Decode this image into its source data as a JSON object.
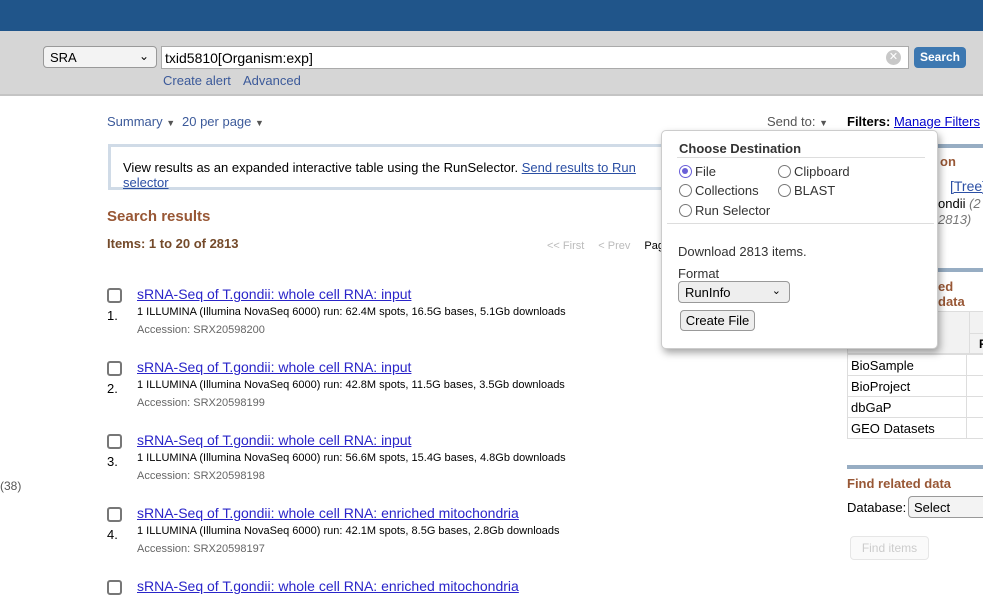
{
  "search": {
    "database": "SRA",
    "term": "txid5810[Organism:exp]",
    "search_label": "Search",
    "create_alert": "Create alert",
    "advanced": "Advanced"
  },
  "toolbar": {
    "summary": "Summary",
    "per_page": "20 per page",
    "send_to": "Send to:",
    "filters_label": "Filters:",
    "manage_filters": "Manage Filters"
  },
  "run_selector": {
    "text": "View results as an expanded interactive table using the RunSelector.",
    "link": "Send results to Run selector"
  },
  "results": {
    "title": "Search results",
    "items": "Items: 1 to 20 of 2813",
    "pager": {
      "first": "<< First",
      "prev": "< Prev",
      "page": "Page"
    },
    "list": [
      {
        "num": "1.",
        "title": "sRNA-Seq of T.gondii: whole cell RNA: input",
        "desc": "1 ILLUMINA (Illumina NovaSeq 6000) run: 62.4M spots, 16.5G bases, 5.1Gb downloads",
        "accession": "Accession: SRX20598200"
      },
      {
        "num": "2.",
        "title": "sRNA-Seq of T.gondii: whole cell RNA: input",
        "desc": "1 ILLUMINA (Illumina NovaSeq 6000) run: 42.8M spots, 11.5G bases, 3.5Gb downloads",
        "accession": "Accession: SRX20598199"
      },
      {
        "num": "3.",
        "title": "sRNA-Seq of T.gondii: whole cell RNA: input",
        "desc": "1 ILLUMINA (Illumina NovaSeq 6000) run: 56.6M spots, 15.4G bases, 4.8Gb downloads",
        "accession": "Accession: SRX20598198"
      },
      {
        "num": "4.",
        "title": "sRNA-Seq of T.gondii: whole cell RNA: enriched mitochondria",
        "desc": "1 ILLUMINA (Illumina NovaSeq 6000) run: 42.1M spots, 8.5G bases, 2.8Gb downloads",
        "accession": "Accession: SRX20598197"
      },
      {
        "num": "",
        "title": "sRNA-Seq of T.gondii: whole cell RNA: enriched mitochondria",
        "desc": "",
        "accession": ""
      }
    ]
  },
  "left_count": "(38)",
  "right": {
    "heading1_fragment": "on",
    "tree": "[Tree]",
    "organism_fragment": "ondii",
    "count_fragment1": "(2",
    "count_fragment2": "2813)",
    "heading2_fragment": "ed data",
    "table_header_fragment": "R",
    "related": [
      "BioSample",
      "BioProject",
      "dbGaP",
      "GEO Datasets"
    ],
    "find_heading": "Find related data",
    "database_label": "Database:",
    "database_value": "Select",
    "find_items": "Find items"
  },
  "popup": {
    "title": "Choose Destination",
    "options": [
      {
        "label": "File",
        "selected": true
      },
      {
        "label": "Clipboard",
        "selected": false
      },
      {
        "label": "Collections",
        "selected": false
      },
      {
        "label": "BLAST",
        "selected": false
      },
      {
        "label": "Run Selector",
        "selected": false
      }
    ],
    "download_text": "Download 2813 items.",
    "format_label": "Format",
    "format_value": "RunInfo",
    "create_file": "Create File"
  },
  "colors": {
    "header": "#20558a",
    "search_button": "#3d78b1",
    "heading": "#985735",
    "link": "#2a25c9"
  }
}
